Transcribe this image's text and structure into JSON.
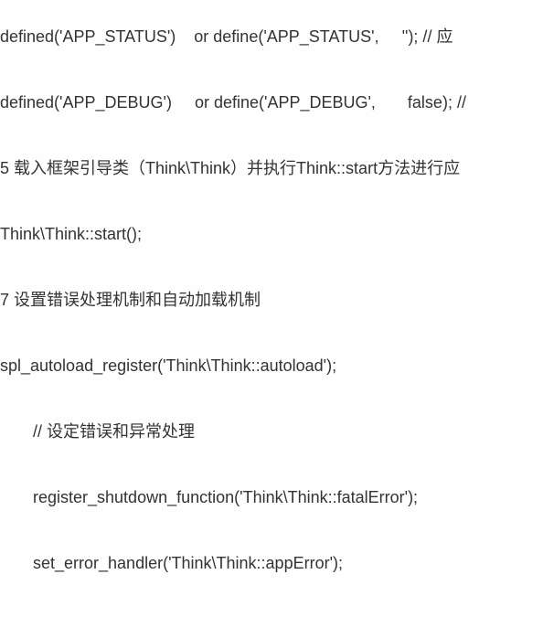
{
  "code": {
    "line1": "defined('APP_STATUS')    or define('APP_STATUS',     ''); // 应",
    "line2": "defined('APP_DEBUG')     or define('APP_DEBUG',       false); //",
    "line3": "5 载入框架引导类（Think\\Think）并执行Think::start方法进行应",
    "line4": "Think\\Think::start();",
    "line5": "7 设置错误处理机制和自动加载机制",
    "line6": "spl_autoload_register('Think\\Think::autoload');",
    "line7": "// 设定错误和异常处理",
    "line8": "register_shutdown_function('Think\\Think::fatalError');",
    "line9": "set_error_handler('Think\\Think::appError');"
  }
}
